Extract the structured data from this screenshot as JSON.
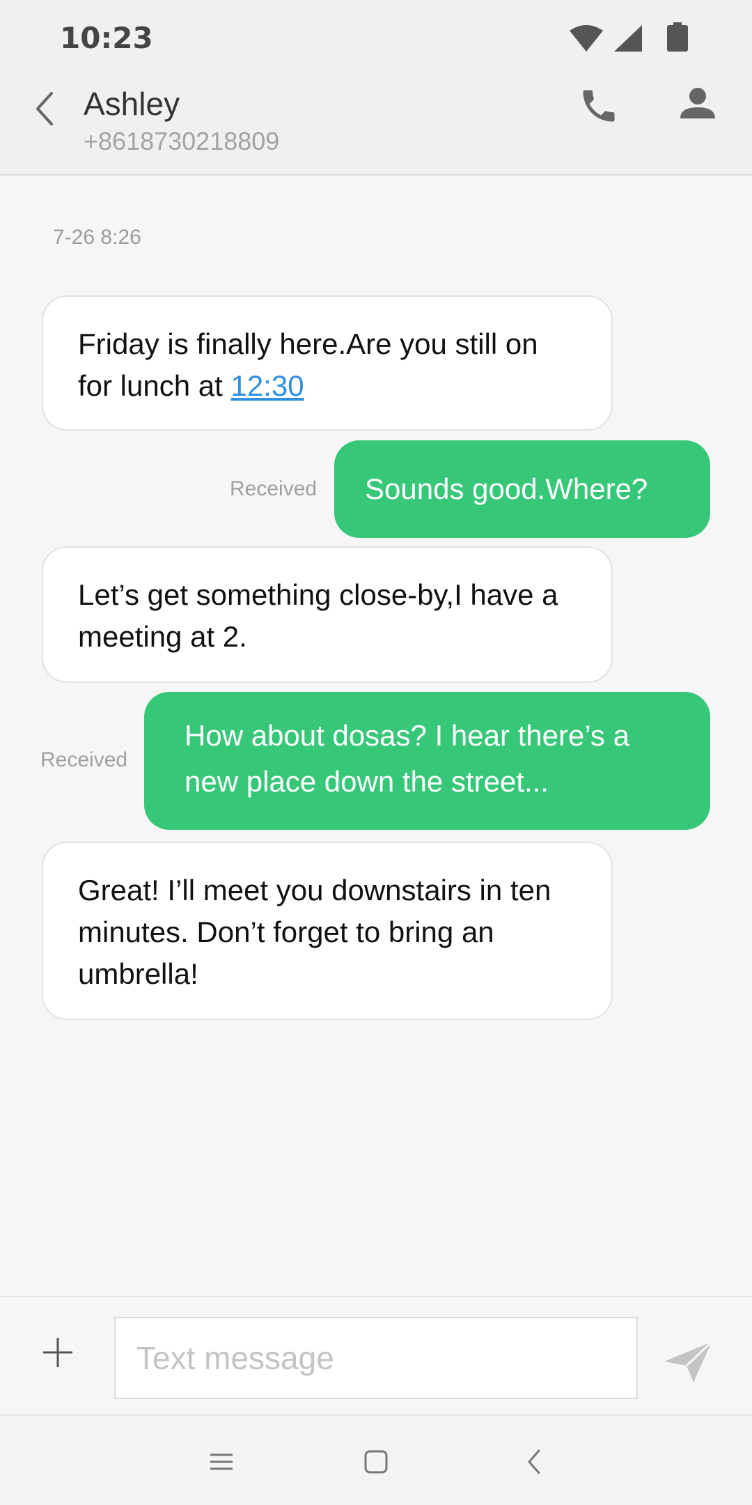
{
  "status_bar": {
    "time": "10:23",
    "icons": [
      "wifi-icon",
      "signal-icon",
      "battery-icon"
    ]
  },
  "header": {
    "back_icon": "chevron-left-icon",
    "contact_name": "Ashley",
    "contact_number": "+8618730218809",
    "call_icon": "phone-icon",
    "profile_icon": "person-icon"
  },
  "conversation": {
    "date": "7-26 8:26",
    "messages": [
      {
        "direction": "incoming",
        "text_before_link": "Friday is finally here.Are you still on for lunch at ",
        "link": "12:30"
      },
      {
        "direction": "outgoing",
        "text": "Sounds good.Where?",
        "status": "Received"
      },
      {
        "direction": "incoming",
        "text": "Let’s get something close-by,I have a meeting at 2."
      },
      {
        "direction": "outgoing",
        "text": "How about dosas? I hear there’s a new place down the street...",
        "status": "Received"
      },
      {
        "direction": "incoming",
        "text": "Great! I’ll meet you downstairs in ten minutes. Don’t forget to bring an umbrella!"
      }
    ]
  },
  "composer": {
    "add_icon": "plus-icon",
    "placeholder": "Text message",
    "value": "",
    "send_icon": "send-icon"
  },
  "nav_bar": {
    "icons": [
      "menu-icon",
      "home-icon",
      "back-icon"
    ]
  },
  "colors": {
    "outgoing_bubble": "#37c779",
    "incoming_bubble": "#ffffff",
    "link": "#2f8fe0",
    "background": "#f6f6f6"
  }
}
